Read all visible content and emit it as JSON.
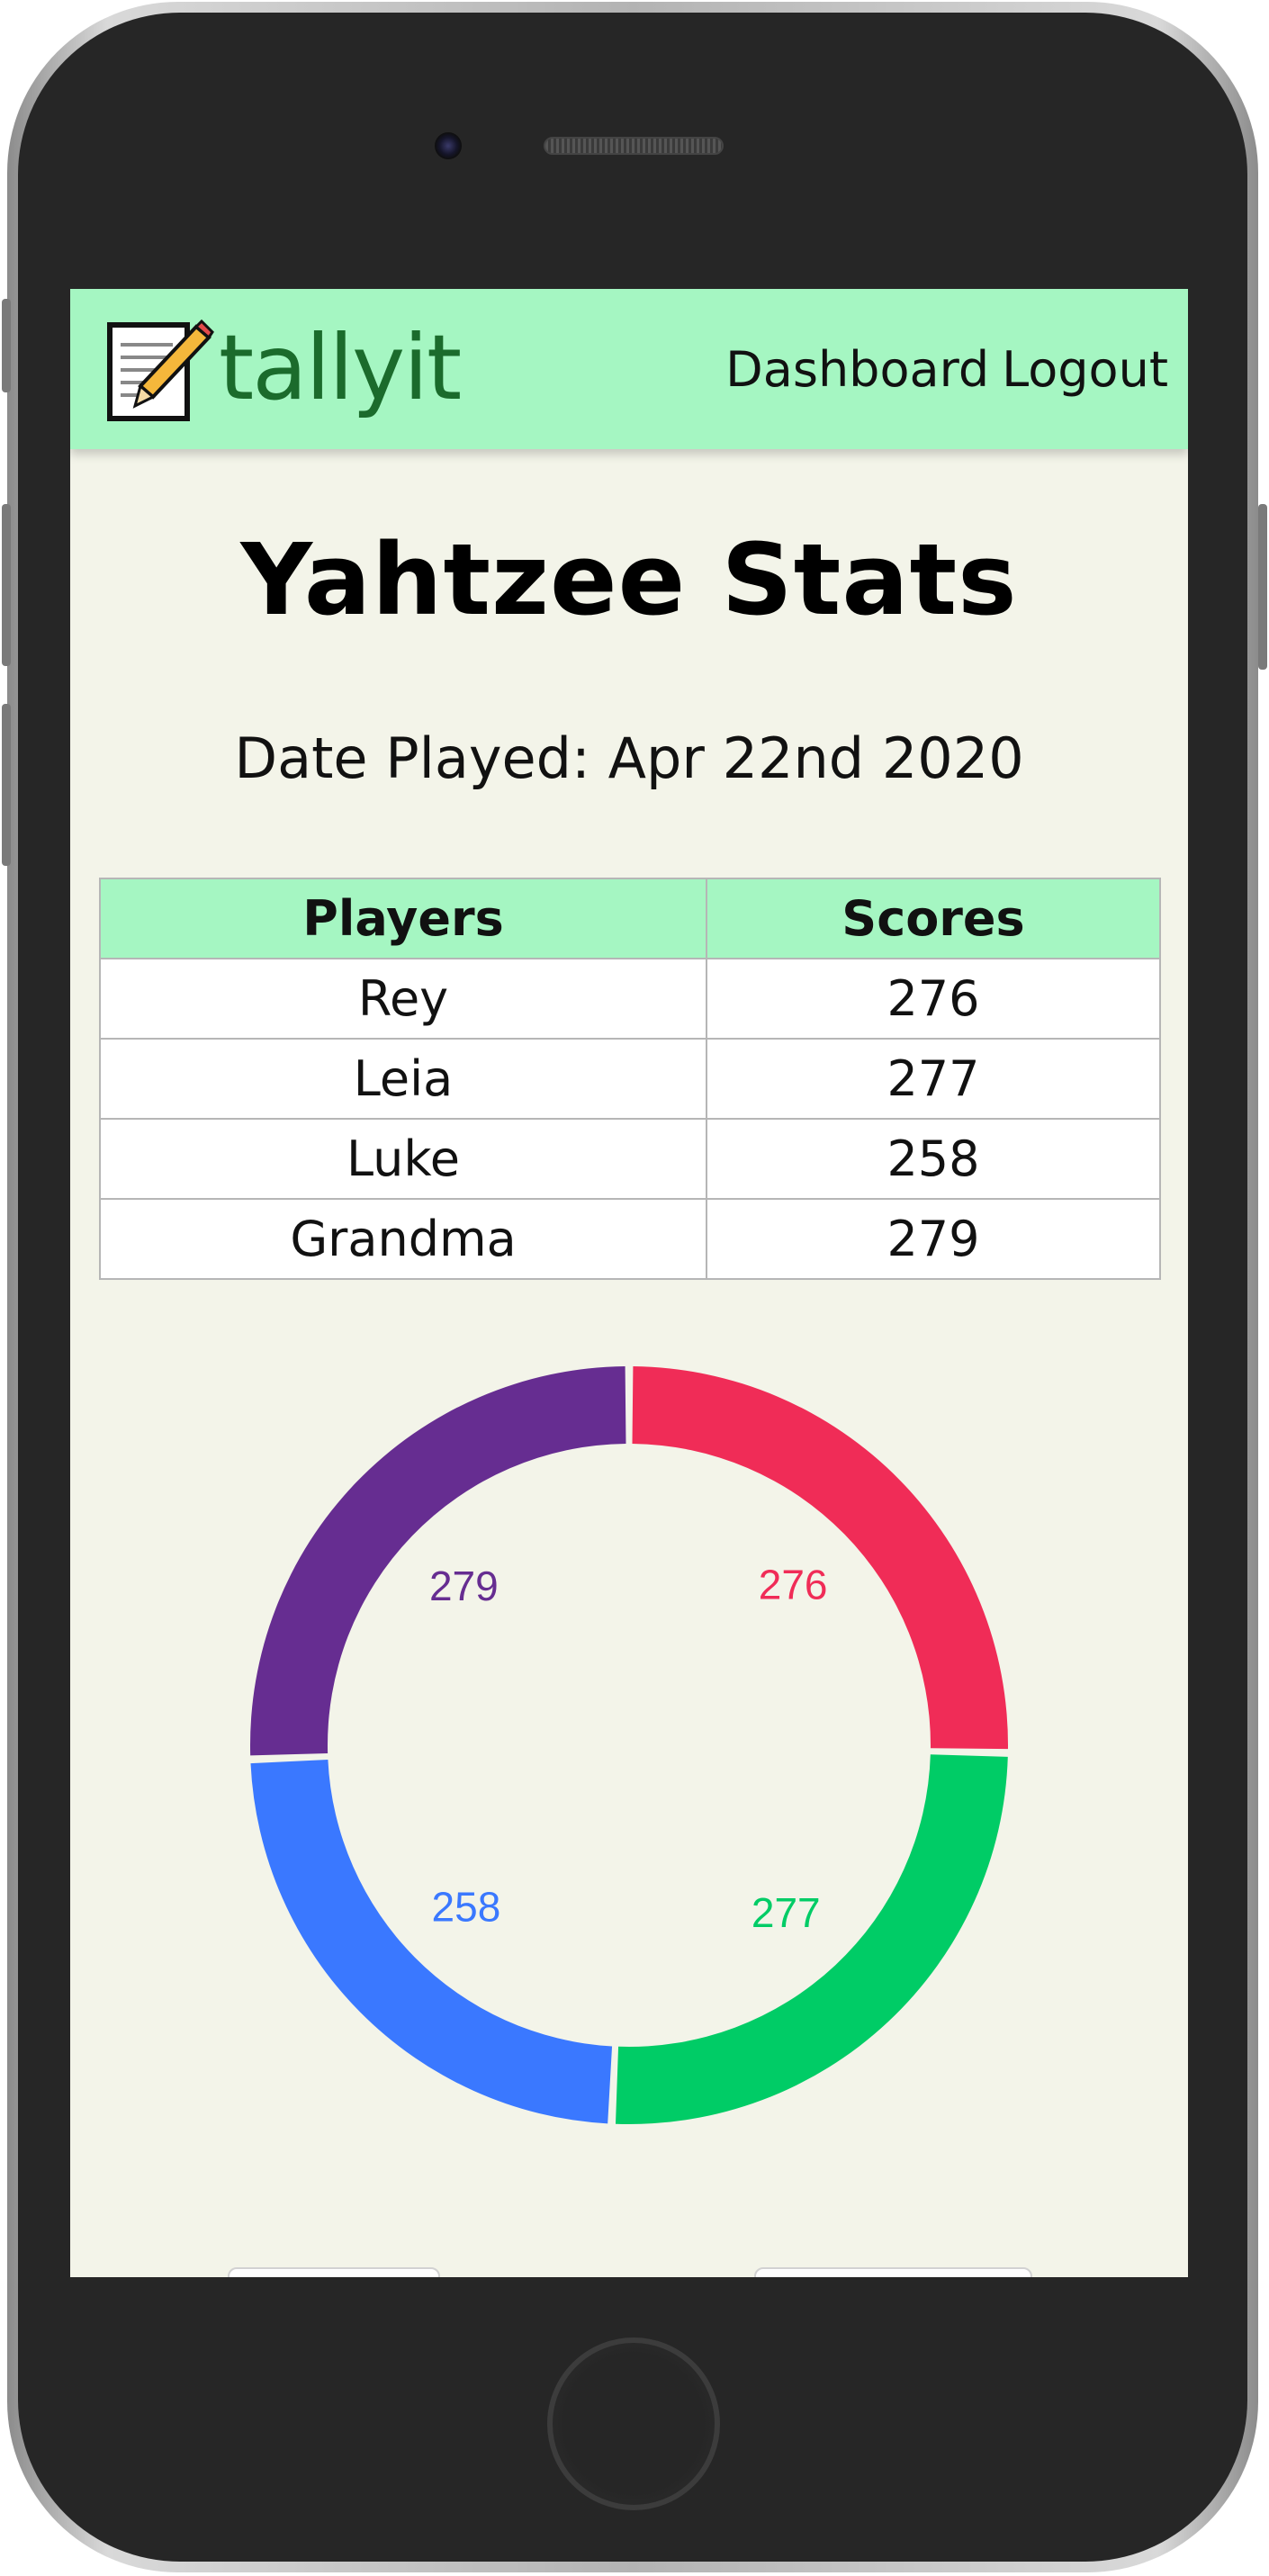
{
  "app": {
    "logo_text": "tallyit",
    "nav": {
      "dashboard": "Dashboard",
      "logout": "Logout"
    }
  },
  "page": {
    "title": "Yahtzee Stats",
    "date_played": "Date Played: Apr 22nd 2020"
  },
  "table": {
    "headers": [
      "Players",
      "Scores"
    ],
    "rows": [
      {
        "player": "Rey",
        "score": "276"
      },
      {
        "player": "Leia",
        "score": "277"
      },
      {
        "player": "Luke",
        "score": "258"
      },
      {
        "player": "Grandma",
        "score": "279"
      }
    ]
  },
  "chart_data": {
    "type": "pie",
    "categories": [
      "Rey",
      "Leia",
      "Luke",
      "Grandma"
    ],
    "values": [
      276,
      277,
      258,
      279
    ],
    "colors": [
      "#f02c57",
      "#00cc66",
      "#3a78ff",
      "#662d91"
    ],
    "labels": [
      "276",
      "277",
      "258",
      "279"
    ]
  }
}
